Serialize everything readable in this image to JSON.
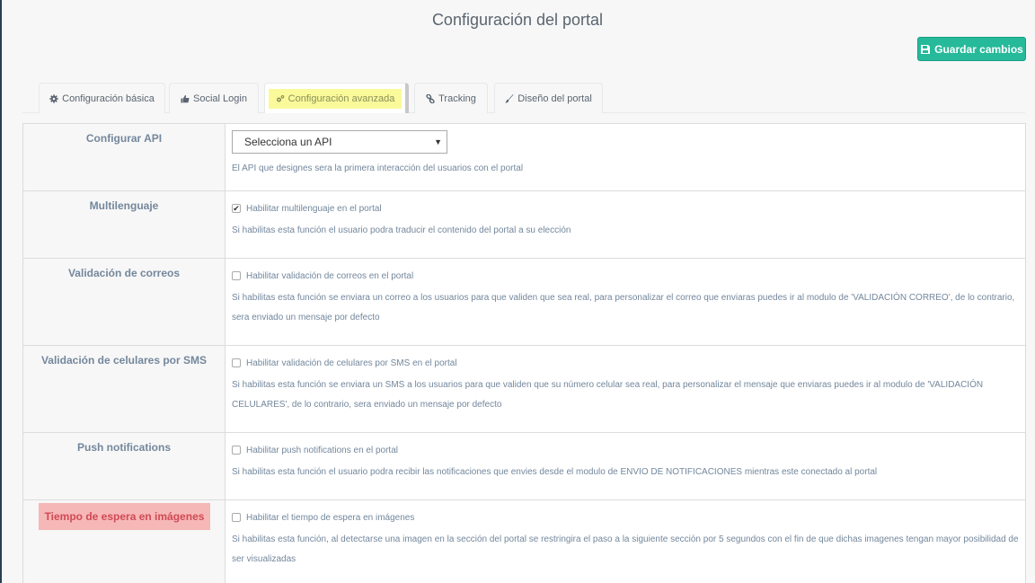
{
  "page": {
    "title": "Configuración del portal"
  },
  "toolbar": {
    "save_label": "Guardar cambios"
  },
  "tabs": [
    {
      "label": "Configuración básica",
      "icon": "gear-icon",
      "active": false
    },
    {
      "label": "Social Login",
      "icon": "thumbs-up-icon",
      "active": false
    },
    {
      "label": "Configuración avanzada",
      "icon": "gears-icon",
      "active": true
    },
    {
      "label": "Tracking",
      "icon": "link-icon",
      "active": false
    },
    {
      "label": "Diseño del portal",
      "icon": "brush-icon",
      "active": false
    }
  ],
  "settings": {
    "api": {
      "label": "Configurar API",
      "select_value": "Selecciona un API",
      "description": "El API que designes sera la primera interacción del usuarios con el portal"
    },
    "multilang": {
      "label": "Multilenguaje",
      "checkbox_label": "Habilitar multilenguaje en el portal",
      "checked": true,
      "description": "Si habilitas esta función el usuario podra traducir el contenido del portal a su elección"
    },
    "email": {
      "label": "Validación de correos",
      "checkbox_label": "Habilitar validación de correos en el portal",
      "checked": false,
      "description": "Si habilitas esta función se enviara un correo a los usuarios para que validen que sea real, para personalizar el correo que enviaras puedes ir al modulo de 'VALIDACIÓN CORREO', de lo contrario, sera enviado un mensaje por defecto"
    },
    "sms": {
      "label": "Validación de celulares por SMS",
      "checkbox_label": "Habilitar validación de celulares por SMS en el portal",
      "checked": false,
      "description": "Si habilitas esta función se enviara un SMS a los usuarios para que validen que su número celular sea real, para personalizar el mensaje que enviaras puedes ir al modulo de 'VALIDACIÓN CELULARES', de lo contrario, sera enviado un mensaje por defecto"
    },
    "push": {
      "label": "Push notifications",
      "checkbox_label": "Habilitar push notifications en el portal",
      "checked": false,
      "description": "Si habilitas esta función el usuario podra recibir las notificaciones que envies desde el modulo de ENVIO DE NOTIFICACIONES mientras este conectado al portal"
    },
    "wait": {
      "label": "Tiempo de espera en imágenes",
      "checkbox_label": "Habilitar el tiempo de espera en imágenes",
      "checked": false,
      "description": "Si habilitas esta función, al detectarse una imagen en la sección del portal se restringira el paso a la siguiente sección por 5 segundos con el fin de que dichas imagenes tengan mayor posibilidad de ser visualizadas"
    }
  },
  "colors": {
    "accent": "#26b99a",
    "highlight_yellow": "#fafa9a",
    "highlight_red": "#f6b7b7"
  }
}
